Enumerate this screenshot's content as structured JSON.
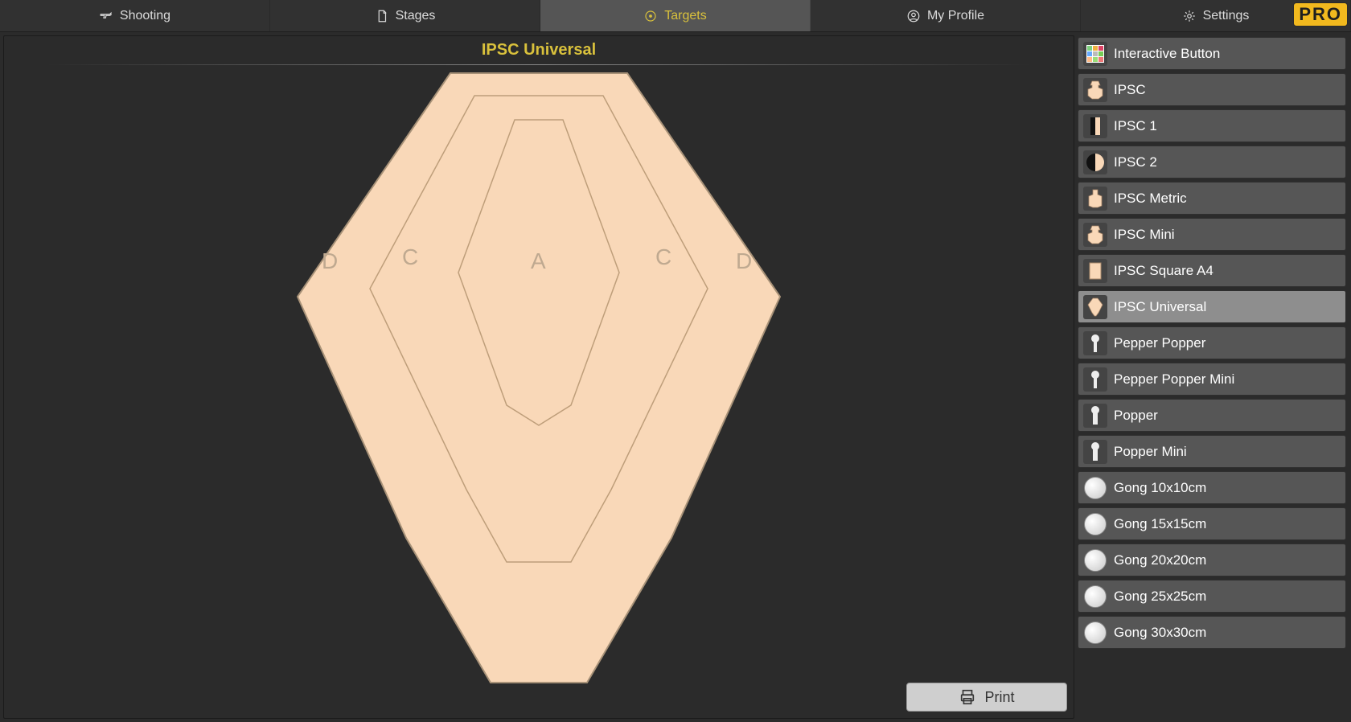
{
  "nav": {
    "tabs": [
      {
        "id": "shooting",
        "label": "Shooting"
      },
      {
        "id": "stages",
        "label": "Stages"
      },
      {
        "id": "targets",
        "label": "Targets"
      },
      {
        "id": "myprofile",
        "label": "My Profile"
      },
      {
        "id": "settings",
        "label": "Settings"
      }
    ],
    "active": "targets",
    "pro_badge": "PRO"
  },
  "preview": {
    "title": "IPSC Universal",
    "zones": {
      "A": "A",
      "C_left": "C",
      "C_right": "C",
      "D_left": "D",
      "D_right": "D"
    }
  },
  "actions": {
    "print_label": "Print"
  },
  "sidebar": {
    "selected": "ipsc-universal",
    "items": [
      {
        "id": "interactive-button",
        "label": "Interactive Button",
        "thumb": "grid"
      },
      {
        "id": "ipsc",
        "label": "IPSC",
        "thumb": "ipsc"
      },
      {
        "id": "ipsc-1",
        "label": "IPSC 1",
        "thumb": "ipsc-half1"
      },
      {
        "id": "ipsc-2",
        "label": "IPSC 2",
        "thumb": "ipsc-half2"
      },
      {
        "id": "ipsc-metric",
        "label": "IPSC Metric",
        "thumb": "ipsc-metric"
      },
      {
        "id": "ipsc-mini",
        "label": "IPSC Mini",
        "thumb": "ipsc"
      },
      {
        "id": "ipsc-square-a4",
        "label": "IPSC Square A4",
        "thumb": "square"
      },
      {
        "id": "ipsc-universal",
        "label": "IPSC Universal",
        "thumb": "universal"
      },
      {
        "id": "pepper-popper",
        "label": "Pepper Popper",
        "thumb": "popper"
      },
      {
        "id": "pepper-popper-mini",
        "label": "Pepper Popper Mini",
        "thumb": "popper"
      },
      {
        "id": "popper",
        "label": "Popper",
        "thumb": "popper2"
      },
      {
        "id": "popper-mini",
        "label": "Popper Mini",
        "thumb": "popper2"
      },
      {
        "id": "gong-10x10cm",
        "label": "Gong 10x10cm",
        "thumb": "circle"
      },
      {
        "id": "gong-15x15cm",
        "label": "Gong 15x15cm",
        "thumb": "circle"
      },
      {
        "id": "gong-20x20cm",
        "label": "Gong 20x20cm",
        "thumb": "circle"
      },
      {
        "id": "gong-25x25cm",
        "label": "Gong 25x25cm",
        "thumb": "circle"
      },
      {
        "id": "gong-30x30cm",
        "label": "Gong 30x30cm",
        "thumb": "circle"
      }
    ]
  }
}
